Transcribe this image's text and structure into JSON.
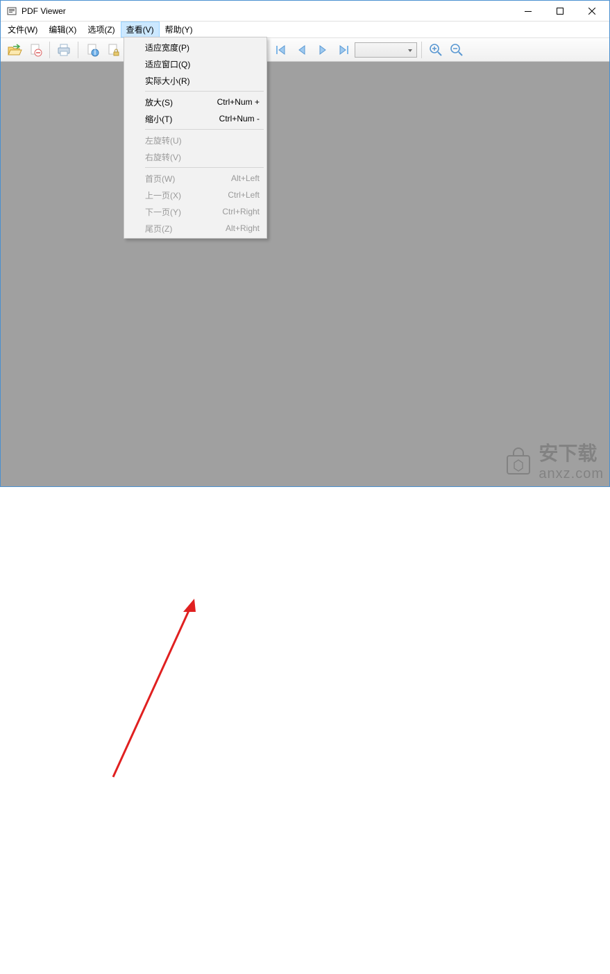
{
  "title": "PDF Viewer",
  "menubar": {
    "file": "文件(W)",
    "edit": "编辑(X)",
    "options": "选项(Z)",
    "view": "查看(V)",
    "help": "帮助(Y)"
  },
  "dropdown": {
    "fit_width": {
      "label": "适应宽度(P)",
      "shortcut": ""
    },
    "fit_window": {
      "label": "适应窗口(Q)",
      "shortcut": ""
    },
    "actual_size": {
      "label": "实际大小(R)",
      "shortcut": ""
    },
    "zoom_in": {
      "label": "放大(S)",
      "shortcut": "Ctrl+Num +"
    },
    "zoom_out": {
      "label": "缩小(T)",
      "shortcut": "Ctrl+Num -"
    },
    "rotate_left": {
      "label": "左旋转(U)",
      "shortcut": ""
    },
    "rotate_right": {
      "label": "右旋转(V)",
      "shortcut": ""
    },
    "first_page": {
      "label": "首页(W)",
      "shortcut": "Alt+Left"
    },
    "prev_page": {
      "label": "上一页(X)",
      "shortcut": "Ctrl+Left"
    },
    "next_page": {
      "label": "下一页(Y)",
      "shortcut": "Ctrl+Right"
    },
    "last_page": {
      "label": "尾页(Z)",
      "shortcut": "Alt+Right"
    }
  },
  "watermark": {
    "text1": "安下载",
    "text2": "anxz.com"
  }
}
